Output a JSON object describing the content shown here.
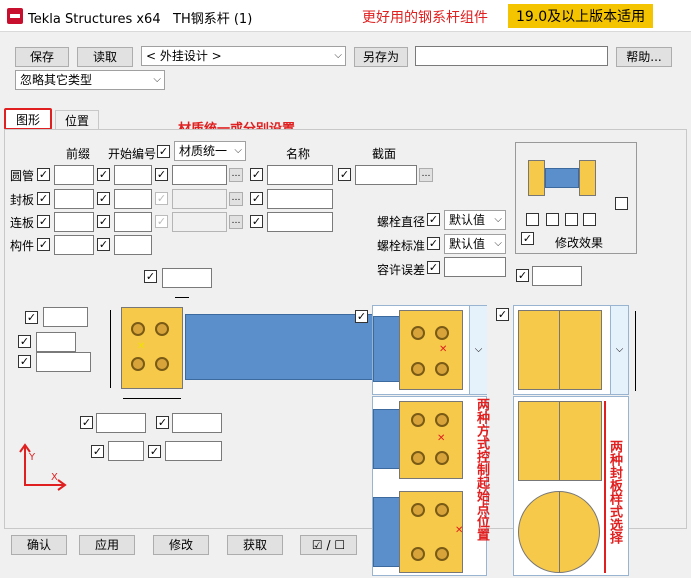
{
  "window": {
    "app_title": "Tekla Structures x64",
    "dialog_title": "TH钢系杆 (1)",
    "annotation": "更好用的钢系杆组件",
    "version_note": "19.0及以上版本适用"
  },
  "toolbar": {
    "save": "保存",
    "load": "读取",
    "preset": "< 外挂设计 >",
    "save_as": "另存为",
    "help": "帮助...",
    "filter": "忽略其它类型"
  },
  "tabs": [
    {
      "label": "图形"
    },
    {
      "label": "位置"
    }
  ],
  "material_note": "材质统一或分别设置",
  "grid": {
    "col_prefix": "前缀",
    "col_start": "开始编号",
    "material_mode": "材质统一",
    "col_name": "名称",
    "col_profile": "截面",
    "rows": [
      {
        "label": "圆管"
      },
      {
        "label": "封板"
      },
      {
        "label": "连板"
      },
      {
        "label": "构件"
      }
    ]
  },
  "bolt": {
    "diameter_label": "螺栓直径",
    "diameter_value": "默认值",
    "standard_label": "螺栓标准",
    "standard_value": "默认值",
    "tolerance_label": "容许误差"
  },
  "preview": {
    "modify_effect": "修改效果"
  },
  "side_notes": {
    "left": "两种方式控制起始点位置",
    "right": "两种封板样式选择"
  },
  "footer": {
    "ok": "确认",
    "apply": "应用",
    "modify": "修改",
    "get": "获取",
    "toggle": "☑ / ☐"
  },
  "colors": {
    "annotation_red": "#e02020",
    "version_bg": "#f5c400",
    "beam": "#5b8fcb",
    "plate": "#f7c94b"
  }
}
